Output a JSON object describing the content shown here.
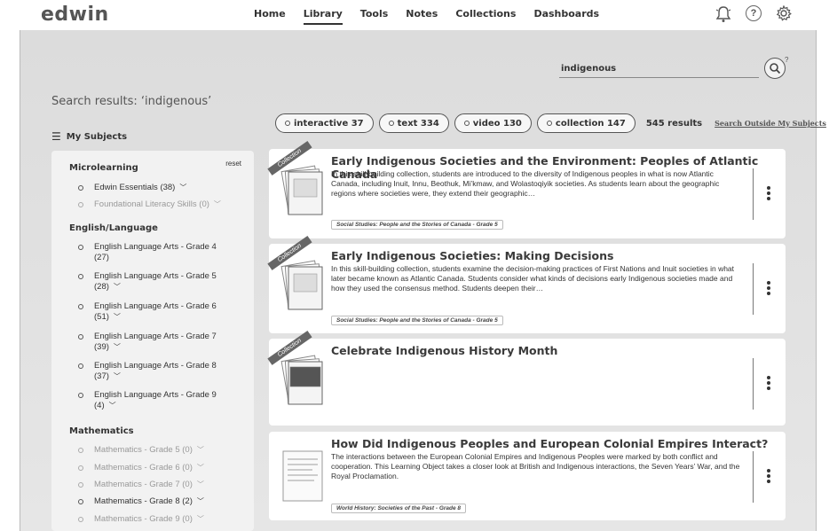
{
  "app": {
    "logo": "edwin"
  },
  "nav": {
    "items": [
      {
        "label": "Home",
        "active": false
      },
      {
        "label": "Library",
        "active": true
      },
      {
        "label": "Tools",
        "active": false
      },
      {
        "label": "Notes",
        "active": false
      },
      {
        "label": "Collections",
        "active": false
      },
      {
        "label": "Dashboards",
        "active": false
      }
    ],
    "icons": [
      "bell-icon",
      "help-icon",
      "gear-icon"
    ]
  },
  "search": {
    "value": "indigenous",
    "help_mark": "?"
  },
  "results": {
    "title": "Search results: ‘indigenous’",
    "count_label": "545 results",
    "outside_link": "Search Outside My Subjects",
    "chips": [
      {
        "label": "interactive 37"
      },
      {
        "label": "text 334"
      },
      {
        "label": "video 130"
      },
      {
        "label": "collection 147"
      }
    ]
  },
  "sidebar": {
    "my_subjects": "My Subjects",
    "reset": "reset",
    "groups": [
      {
        "title": "Microlearning",
        "items": [
          {
            "label": "Edwin Essentials (38)",
            "chev": "﹀",
            "dim": false
          },
          {
            "label": "Foundational Literacy Skills (0)",
            "chev": "﹀",
            "dim": true
          }
        ]
      },
      {
        "title": "English/Language",
        "items": [
          {
            "label": "English Language Arts - Grade 4",
            "sub": "(27)",
            "chev": "",
            "dim": false
          },
          {
            "label": "English Language Arts - Grade 5",
            "sub": "(28)",
            "chev": "﹀",
            "dim": false
          },
          {
            "label": "English Language Arts - Grade 6",
            "sub": "(51)",
            "chev": "﹀",
            "dim": false
          },
          {
            "label": "English Language Arts - Grade 7",
            "sub": "(39)",
            "chev": "﹀",
            "dim": false
          },
          {
            "label": "English Language Arts - Grade 8",
            "sub": "(37)",
            "chev": "﹀",
            "dim": false
          },
          {
            "label": "English Language Arts - Grade 9",
            "sub": "(4)",
            "chev": "﹀",
            "dim": false
          }
        ]
      },
      {
        "title": "Mathematics",
        "items": [
          {
            "label": "Mathematics - Grade 5 (0)",
            "chev": "﹀",
            "dim": true
          },
          {
            "label": "Mathematics - Grade 6 (0)",
            "chev": "﹀",
            "dim": true
          },
          {
            "label": "Mathematics - Grade 7 (0)",
            "chev": "﹀",
            "dim": true
          },
          {
            "label": "Mathematics - Grade 8 (2)",
            "chev": "﹀",
            "dim": false
          },
          {
            "label": "Mathematics - Grade 9 (0)",
            "chev": "﹀",
            "dim": true
          }
        ]
      }
    ]
  },
  "cards": [
    {
      "ribbon": "Collection",
      "title": "Early Indigenous Societies and the Environment: Peoples of Atlantic Canada",
      "desc": "In this skill-building collection, students are introduced to the diversity of Indigenous peoples in what is now Atlantic Canada, including Inuit, Innu, Beothuk, Mi’kmaw, and Wolastoqiyik societies. As students learn about the geographic regions where societies were, they extend their geographic…",
      "tag": "Social Studies: People and the Stories of Canada - Grade 5"
    },
    {
      "ribbon": "Collection",
      "title": "Early Indigenous Societies: Making Decisions",
      "desc": "In this skill-building collection, students examine the decision-making practices of First Nations and Inuit societies in what later became known as Atlantic Canada. Students consider what kinds of decisions early Indigenous societies made and how they used the consensus method. Students deepen their…",
      "tag": "Social Studies: People and the Stories of Canada - Grade 5"
    },
    {
      "ribbon": "Collection",
      "title": "Celebrate Indigenous History Month",
      "desc": "",
      "tag": ""
    },
    {
      "ribbon": "",
      "title": "How Did Indigenous Peoples and European Colonial Empires Interact?",
      "desc": "The interactions between the European Colonial Empires and Indigenous Peoples were marked by both conflict and cooperation. This Learning Object takes a closer look at British and Indigenous interactions, the Seven Years’ War, and the Royal Proclamation.",
      "tag": "World History: Societies of the Past - Grade 8"
    }
  ]
}
